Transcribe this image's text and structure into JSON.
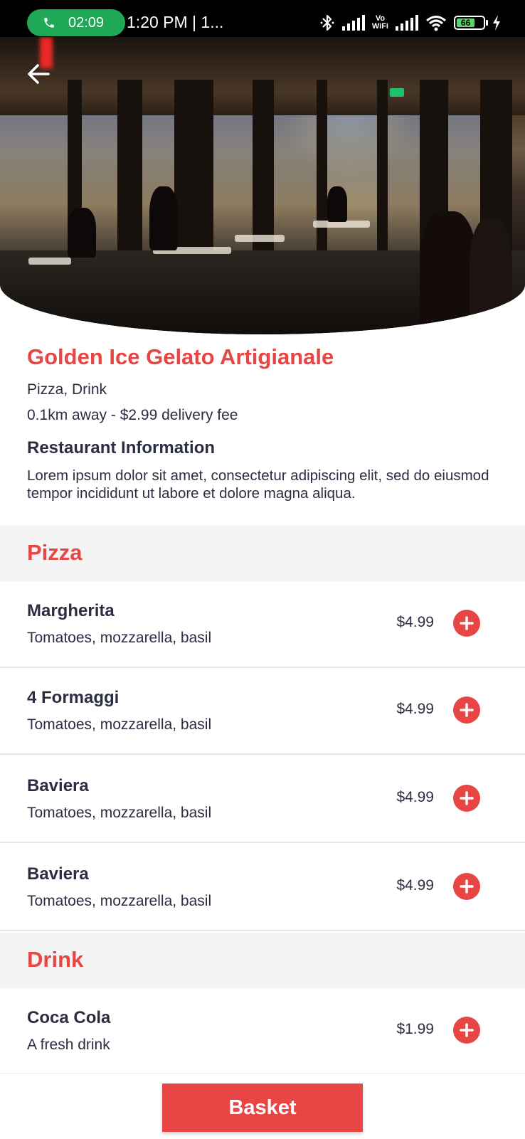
{
  "status_bar": {
    "call_timer": "02:09",
    "time_text": "1:20 PM | 1...",
    "vowifi_top": "Vo",
    "vowifi_bottom": "WiFi",
    "battery": "66"
  },
  "restaurant": {
    "name": "Golden Ice Gelato Artigianale",
    "categories": "Pizza, Drink",
    "distance_fee": "0.1km away - $2.99 delivery fee",
    "info_title": "Restaurant Information",
    "description": "Lorem ipsum dolor sit amet, consectetur adipiscing elit, sed do eiusmod tempor incididunt ut labore et dolore magna aliqua."
  },
  "sections": [
    {
      "title": "Pizza",
      "items": [
        {
          "name": "Margherita",
          "desc": "Tomatoes, mozzarella, basil",
          "price": "$4.99"
        },
        {
          "name": "4 Formaggi",
          "desc": "Tomatoes, mozzarella, basil",
          "price": "$4.99"
        },
        {
          "name": "Baviera",
          "desc": "Tomatoes, mozzarella, basil",
          "price": "$4.99"
        },
        {
          "name": "Baviera",
          "desc": "Tomatoes, mozzarella, basil",
          "price": "$4.99"
        }
      ]
    },
    {
      "title": "Drink",
      "items": [
        {
          "name": "Coca Cola",
          "desc": "A fresh drink",
          "price": "$1.99"
        }
      ]
    }
  ],
  "basket_label": "Basket",
  "colors": {
    "accent": "#e84545",
    "text": "#2b2d42",
    "section_bg": "#f4f4f4"
  },
  "icons": {
    "back": "arrow-left-icon",
    "add": "plus-circle-icon",
    "call": "phone-icon"
  }
}
